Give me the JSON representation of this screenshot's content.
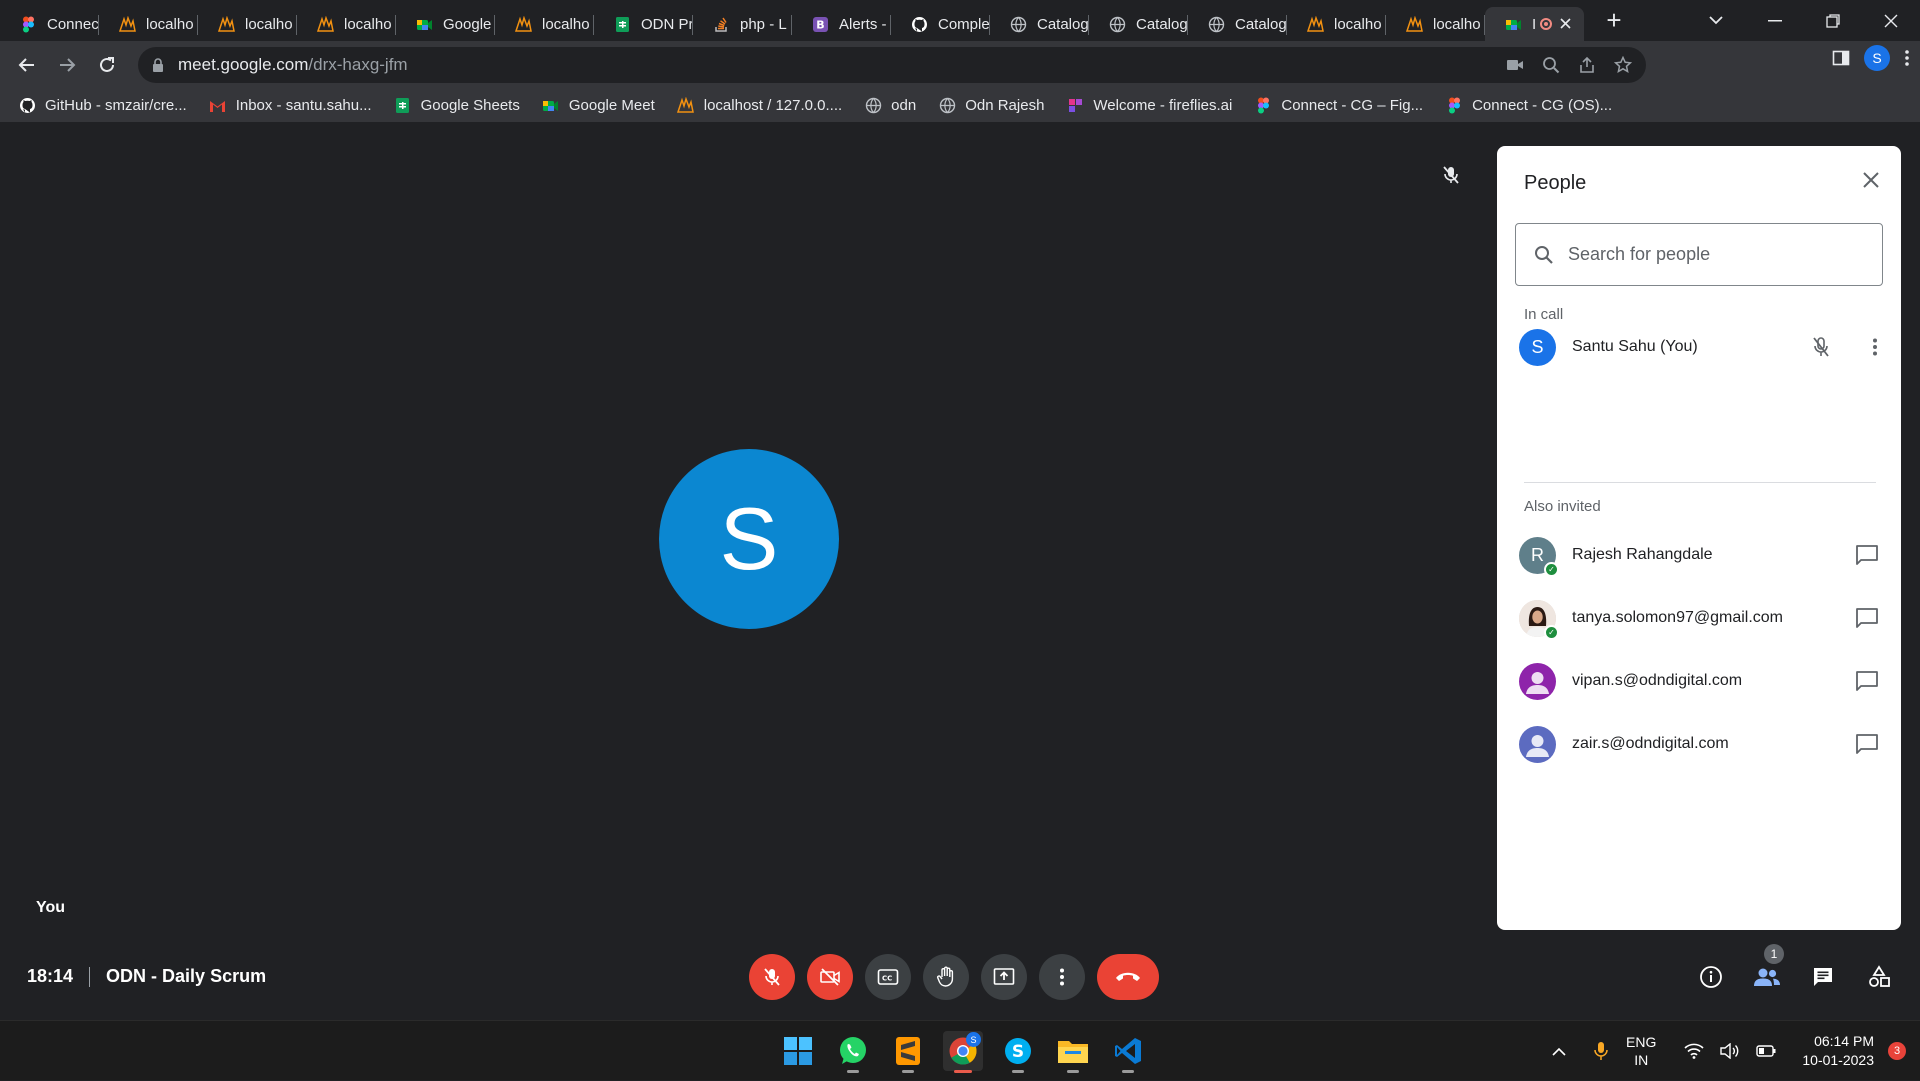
{
  "browser": {
    "tabs": [
      {
        "label": "Connec",
        "icon": "figma-icon",
        "color": "#f24e1e"
      },
      {
        "label": "localho",
        "icon": "phpmyadmin-icon",
        "color": "#f29111"
      },
      {
        "label": "localho",
        "icon": "phpmyadmin-icon",
        "color": "#f29111"
      },
      {
        "label": "localho",
        "icon": "phpmyadmin-icon",
        "color": "#f29111"
      },
      {
        "label": "Google",
        "icon": "google-meet-icon",
        "color": "#00832d"
      },
      {
        "label": "localho",
        "icon": "phpmyadmin-icon",
        "color": "#f29111"
      },
      {
        "label": "ODN Pr",
        "icon": "google-sheets-icon",
        "color": "#0f9d58"
      },
      {
        "label": "php - L",
        "icon": "stackoverflow-icon",
        "color": "#f48024"
      },
      {
        "label": "Alerts -",
        "icon": "bootstrap-icon",
        "color": "#7952b3"
      },
      {
        "label": "Comple",
        "icon": "github-icon",
        "color": "#ffffff"
      },
      {
        "label": "Catalog",
        "icon": "globe-icon",
        "color": "#bdc1c6"
      },
      {
        "label": "Catalog",
        "icon": "globe-icon",
        "color": "#bdc1c6"
      },
      {
        "label": "Catalog",
        "icon": "globe-icon",
        "color": "#bdc1c6"
      },
      {
        "label": "localho",
        "icon": "phpmyadmin-icon",
        "color": "#f29111"
      },
      {
        "label": "localho",
        "icon": "phpmyadmin-icon",
        "color": "#f29111"
      }
    ],
    "active_tab": {
      "label": "I",
      "icon": "google-meet-icon"
    },
    "new_tab": "+",
    "url_host": "meet.google.com",
    "url_path": "/drx-haxg-jfm",
    "profile_initial": "S"
  },
  "bookmarks": [
    {
      "label": "GitHub - smzair/cre...",
      "icon": "github-icon",
      "color": "#ffffff"
    },
    {
      "label": "Inbox - santu.sahu...",
      "icon": "gmail-icon",
      "color": "#ea4335"
    },
    {
      "label": "Google Sheets",
      "icon": "google-sheets-icon",
      "color": "#0f9d58"
    },
    {
      "label": "Google Meet",
      "icon": "google-meet-icon",
      "color": "#00832d"
    },
    {
      "label": "localhost / 127.0.0....",
      "icon": "phpmyadmin-icon",
      "color": "#f29111"
    },
    {
      "label": "odn",
      "icon": "globe-icon",
      "color": "#bdc1c6"
    },
    {
      "label": "Odn Rajesh",
      "icon": "globe-icon",
      "color": "#bdc1c6"
    },
    {
      "label": "Welcome - fireflies.ai",
      "icon": "fireflies-icon",
      "color": "#e4348b"
    },
    {
      "label": "Connect - CG – Fig...",
      "icon": "figma-icon",
      "color": "#f24e1e"
    },
    {
      "label": "Connect - CG (OS)...",
      "icon": "figma-icon",
      "color": "#f24e1e"
    }
  ],
  "stage": {
    "avatar_initial": "S",
    "self_label": "You"
  },
  "people_panel": {
    "title": "People",
    "search_placeholder": "Search for people",
    "in_call_heading": "In call",
    "in_call": [
      {
        "name": "Santu Sahu (You)",
        "initial": "S",
        "color": "#1a73e8"
      }
    ],
    "also_invited_heading": "Also invited",
    "also_invited": [
      {
        "name": "Rajesh Rahangdale",
        "initial": "R",
        "color": "#5f7f8a",
        "accepted": true
      },
      {
        "name": "tanya.solomon97@gmail.com",
        "initial": "",
        "color": "#d7ccc8",
        "accepted": true,
        "photo": true
      },
      {
        "name": "vipan.s@odndigital.com",
        "initial": "",
        "color": "#8e24aa",
        "accepted": false
      },
      {
        "name": "zair.s@odndigital.com",
        "initial": "",
        "color": "#5c6bc0",
        "accepted": false
      }
    ]
  },
  "meeting": {
    "time": "18:14",
    "name": "ODN - Daily Scrum",
    "participant_count": "1"
  },
  "taskbar": {
    "lang_top": "ENG",
    "lang_bottom": "IN",
    "clock_time": "06:14 PM",
    "clock_date": "10-01-2023",
    "notification_count": "3",
    "chrome_badge": "S"
  }
}
